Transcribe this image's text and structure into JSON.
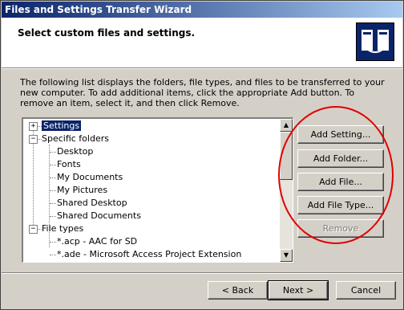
{
  "window": {
    "title": "Files and Settings Transfer Wizard"
  },
  "header": {
    "title": "Select custom files and settings."
  },
  "description": "The following list displays the folders, file types, and files to be transferred to your new computer. To add additional items, click the appropriate Add button. To remove an item, select it, and then click Remove.",
  "tree": {
    "items": [
      {
        "label": "Settings",
        "level": 0,
        "expander": "+",
        "selected": true
      },
      {
        "label": "Specific folders",
        "level": 0,
        "expander": "-"
      },
      {
        "label": "Desktop",
        "level": 1
      },
      {
        "label": "Fonts",
        "level": 1
      },
      {
        "label": "My Documents",
        "level": 1
      },
      {
        "label": "My Pictures",
        "level": 1
      },
      {
        "label": "Shared Desktop",
        "level": 1
      },
      {
        "label": "Shared Documents",
        "level": 1
      },
      {
        "label": "File types",
        "level": 0,
        "expander": "-"
      },
      {
        "label": "*.acp - AAC for SD",
        "level": 1
      },
      {
        "label": "*.ade - Microsoft Access Project Extension",
        "level": 1
      }
    ]
  },
  "side_buttons": {
    "add_setting": "Add Setting...",
    "add_folder": "Add Folder...",
    "add_file": "Add File...",
    "add_file_type": "Add File Type...",
    "remove": "Remove"
  },
  "footer": {
    "back": "< Back",
    "next": "Next >",
    "cancel": "Cancel"
  },
  "colors": {
    "titlebar": "#0a246a",
    "selection": "#0a246a",
    "annotation": "#e00000"
  }
}
